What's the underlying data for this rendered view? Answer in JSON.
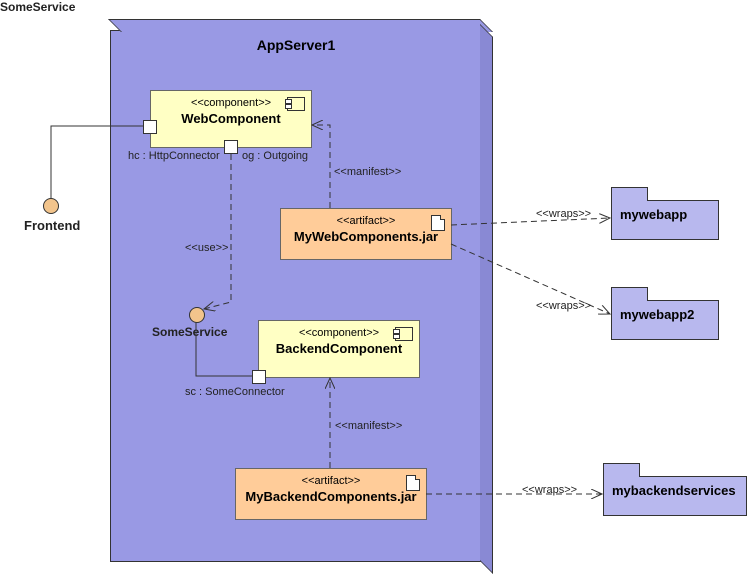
{
  "appServer": {
    "title": "AppServer1"
  },
  "webComponent": {
    "stereo": "<<component>>",
    "name": "WebComponent",
    "port1": "hc : HttpConnector",
    "port2": "og : Outgoing"
  },
  "backendComponent": {
    "stereo": "<<component>>",
    "name": "BackendComponent",
    "port": "sc : SomeConnector"
  },
  "artifact1": {
    "stereo": "<<artifact>>",
    "name": "MyWebComponents.jar"
  },
  "artifact2": {
    "stereo": "<<artifact>>",
    "name": "MyBackendComponents.jar"
  },
  "frontend": {
    "label": "Frontend"
  },
  "someService": {
    "label": "SomeService"
  },
  "packages": {
    "p1": "mywebapp",
    "p2": "mywebapp2",
    "p3": "mybackendservices"
  },
  "edges": {
    "manifest": "<<manifest>>",
    "use": "<<use>>",
    "wraps": "<<wraps>>"
  }
}
